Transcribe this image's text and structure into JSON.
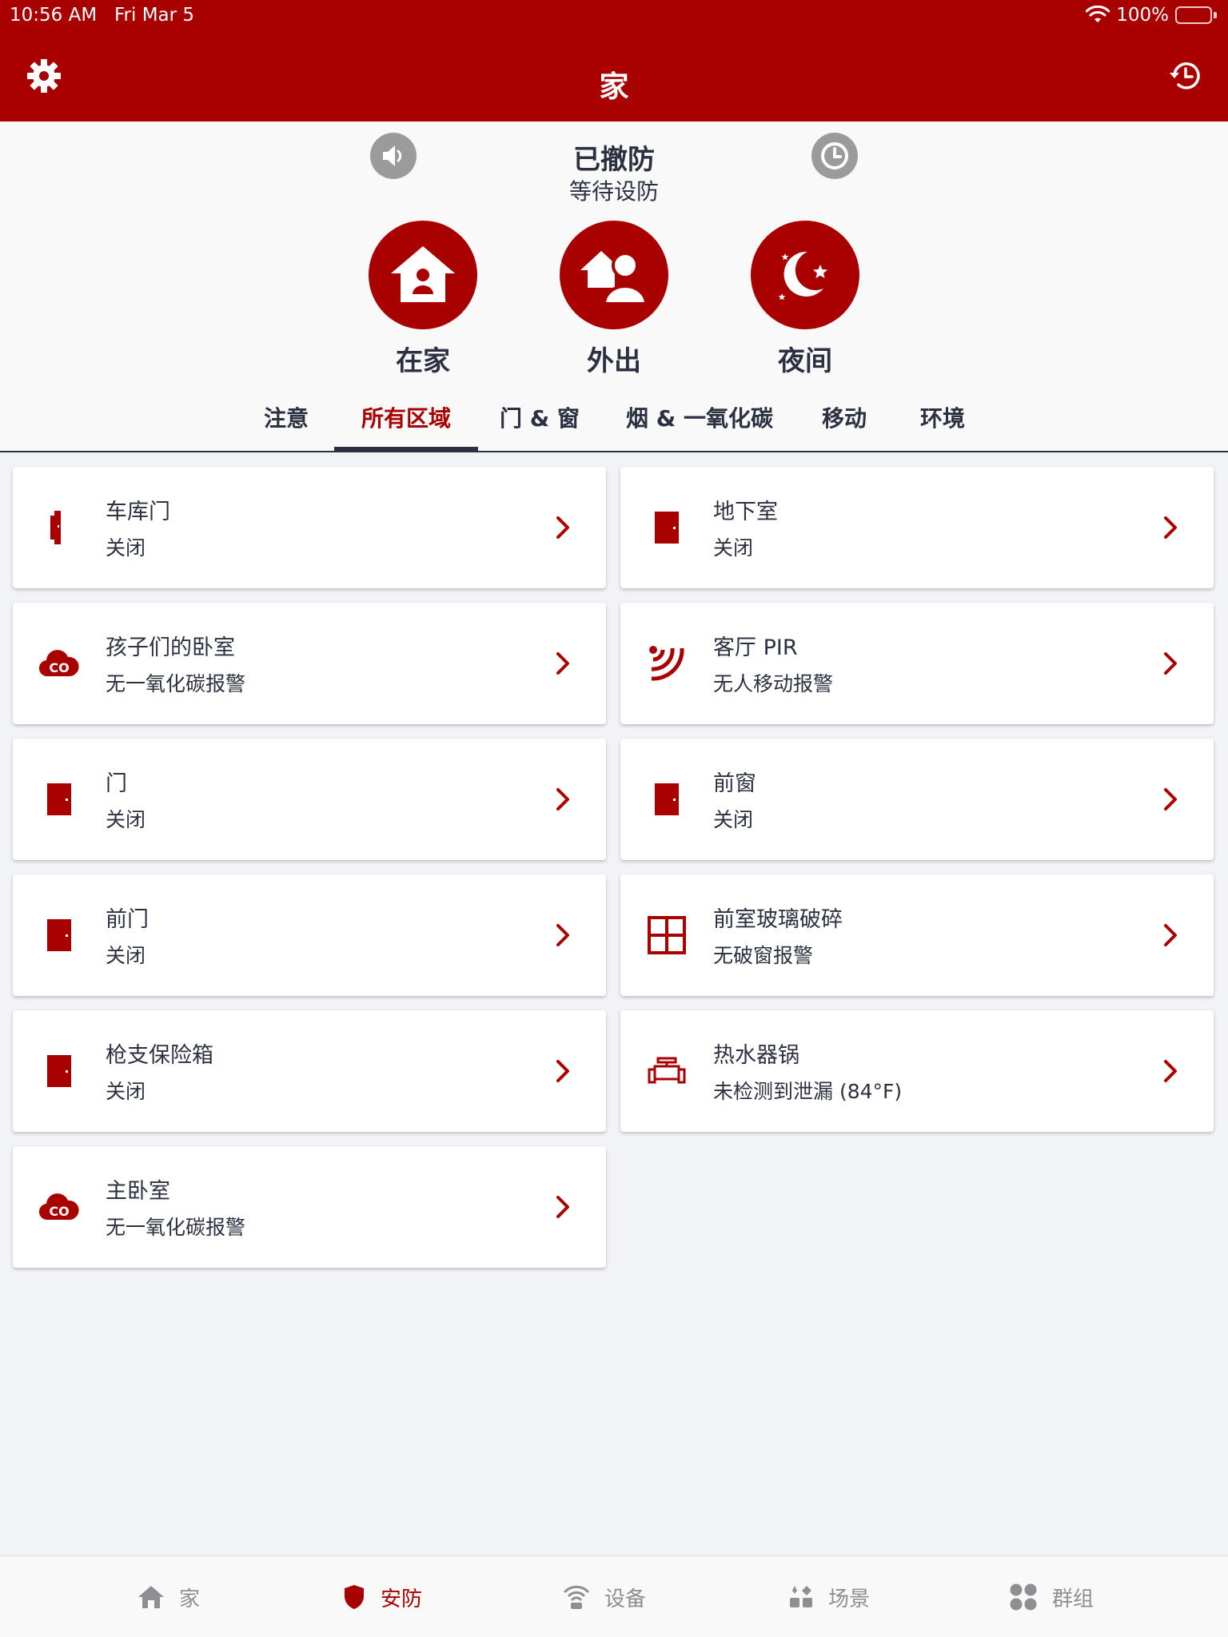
{
  "status_bar": {
    "time": "10:56 AM",
    "date": "Fri Mar 5",
    "battery": "100%"
  },
  "header": {
    "title": "家"
  },
  "security": {
    "state": "已撤防",
    "substate": "等待设防",
    "modes": [
      {
        "label": "在家"
      },
      {
        "label": "外出"
      },
      {
        "label": "夜间"
      }
    ]
  },
  "tabs": [
    {
      "label": "注意"
    },
    {
      "label": "所有区域",
      "active": true
    },
    {
      "label": "门 & 窗"
    },
    {
      "label": "烟 & 一氧化碳"
    },
    {
      "label": "移动"
    },
    {
      "label": "环境"
    }
  ],
  "zones": [
    {
      "title": "车库门",
      "status": "关闭",
      "icon": "garage-door-icon"
    },
    {
      "title": "地下室",
      "status": "关闭",
      "icon": "door-icon"
    },
    {
      "title": "孩子们的卧室",
      "status": "无一氧化碳报警",
      "icon": "co-icon"
    },
    {
      "title": "客厅 PIR",
      "status": "无人移动报警",
      "icon": "motion-icon"
    },
    {
      "title": "门",
      "status": "关闭",
      "icon": "door-icon"
    },
    {
      "title": "前窗",
      "status": "关闭",
      "icon": "door-icon"
    },
    {
      "title": "前门",
      "status": "关闭",
      "icon": "door-icon"
    },
    {
      "title": "前室玻璃破碎",
      "status": "无破窗报警",
      "icon": "glass-break-icon"
    },
    {
      "title": "枪支保险箱",
      "status": "关闭",
      "icon": "door-icon"
    },
    {
      "title": "热水器锅",
      "status": "未检测到泄漏 (84°F)",
      "icon": "water-leak-icon"
    },
    {
      "title": "主卧室",
      "status": "无一氧化碳报警",
      "icon": "co-icon"
    }
  ],
  "bottom_nav": [
    {
      "label": "家",
      "icon": "home-icon"
    },
    {
      "label": "安防",
      "icon": "shield-icon",
      "active": true
    },
    {
      "label": "设备",
      "icon": "wifi-device-icon"
    },
    {
      "label": "场景",
      "icon": "scenes-icon"
    },
    {
      "label": "群组",
      "icon": "groups-icon"
    }
  ],
  "colors": {
    "brand": "#a90000",
    "text": "#2c3141",
    "inactive": "#8e8e93"
  }
}
